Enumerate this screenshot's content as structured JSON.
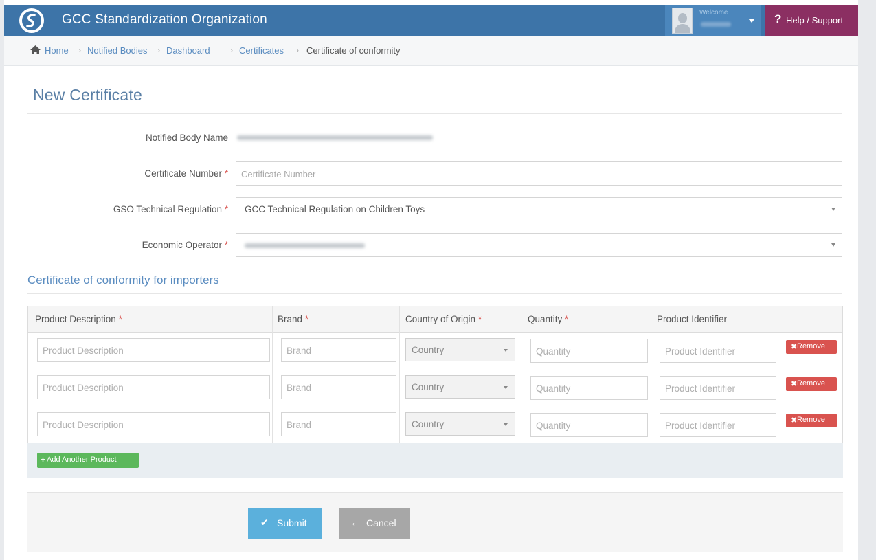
{
  "app": {
    "title": "GCC Standardization Organization"
  },
  "user": {
    "welcome": "Welcome"
  },
  "help": {
    "icon": "?",
    "label": "Help / Support"
  },
  "breadcrumb": {
    "items": [
      "Home",
      "Notified Bodies",
      "Dashboard",
      "Certificates",
      "Certificate of conformity"
    ],
    "separator": "›"
  },
  "page": {
    "title": "New Certificate"
  },
  "form": {
    "required_mark": "*",
    "notified_body": {
      "label": "Notified Body Name"
    },
    "certificate_number": {
      "label": "Certificate Number",
      "placeholder": "Certificate Number",
      "value": ""
    },
    "regulation": {
      "label": "GSO Technical Regulation",
      "value": "GCC Technical Regulation on Children Toys"
    },
    "economic_operator": {
      "label": "Economic Operator"
    }
  },
  "section": {
    "title": "Certificate of conformity for importers"
  },
  "table": {
    "headers": {
      "product_description": "Product Description",
      "brand": "Brand",
      "country": "Country of Origin",
      "quantity": "Quantity",
      "identifier": "Product Identifier"
    },
    "rows": [
      {
        "product_description": "Product Description",
        "brand": "Brand",
        "country": "Country",
        "quantity": "Quantity",
        "identifier": "Product Identifier",
        "remove_icon": "✖",
        "remove_label": "Remove"
      },
      {
        "product_description": "Product Description",
        "brand": "Brand",
        "country": "Country",
        "quantity": "Quantity",
        "identifier": "Product Identifier",
        "remove_icon": "✖",
        "remove_label": "Remove"
      },
      {
        "product_description": "Product Description",
        "brand": "Brand",
        "country": "Country",
        "quantity": "Quantity",
        "identifier": "Product Identifier",
        "remove_icon": "✖",
        "remove_label": "Remove"
      }
    ],
    "add_button": {
      "icon": "+",
      "label": "Add Another Product"
    }
  },
  "actions": {
    "submit": {
      "icon": "✔",
      "label": "Submit"
    },
    "cancel": {
      "icon": "←",
      "label": "Cancel"
    }
  },
  "colors": {
    "topbar": "#3d74a8",
    "help": "#8b2f62",
    "link": "#5a8cc0",
    "required": "#d9534f",
    "remove": "#d9534f",
    "add": "#5cb85c",
    "submit": "#5bb0dc",
    "cancel": "#a7a7a7"
  }
}
